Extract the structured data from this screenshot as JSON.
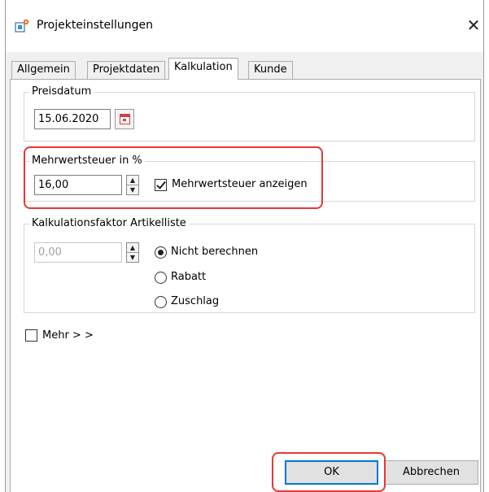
{
  "window": {
    "title": "Projekteinstellungen",
    "icon": "project-settings-icon",
    "close_glyph": "✕"
  },
  "tabs": [
    {
      "label": "Allgemein",
      "active": false
    },
    {
      "label": "Projektdaten",
      "active": false
    },
    {
      "label": "Kalkulation",
      "active": true
    },
    {
      "label": "Kunde",
      "active": false
    }
  ],
  "preisdatum": {
    "legend": "Preisdatum",
    "value": "15.06.2020"
  },
  "mwst": {
    "legend": "Mehrwertsteuer in %",
    "value": "16,00",
    "show_label": "Mehrwertsteuer anzeigen",
    "show_checked": true
  },
  "kalkfaktor": {
    "legend": "Kalkulationsfaktor Artikelliste",
    "value": "0,00",
    "options": [
      {
        "label": "Nicht berechnen",
        "checked": true
      },
      {
        "label": "Rabatt",
        "checked": false
      },
      {
        "label": "Zuschlag",
        "checked": false
      }
    ]
  },
  "mehr": {
    "label": "Mehr > >",
    "checked": false
  },
  "buttons": {
    "ok": "OK",
    "cancel": "Abbrechen"
  },
  "colors": {
    "highlight": "#e53935",
    "default_button_border": "#0078d7"
  }
}
